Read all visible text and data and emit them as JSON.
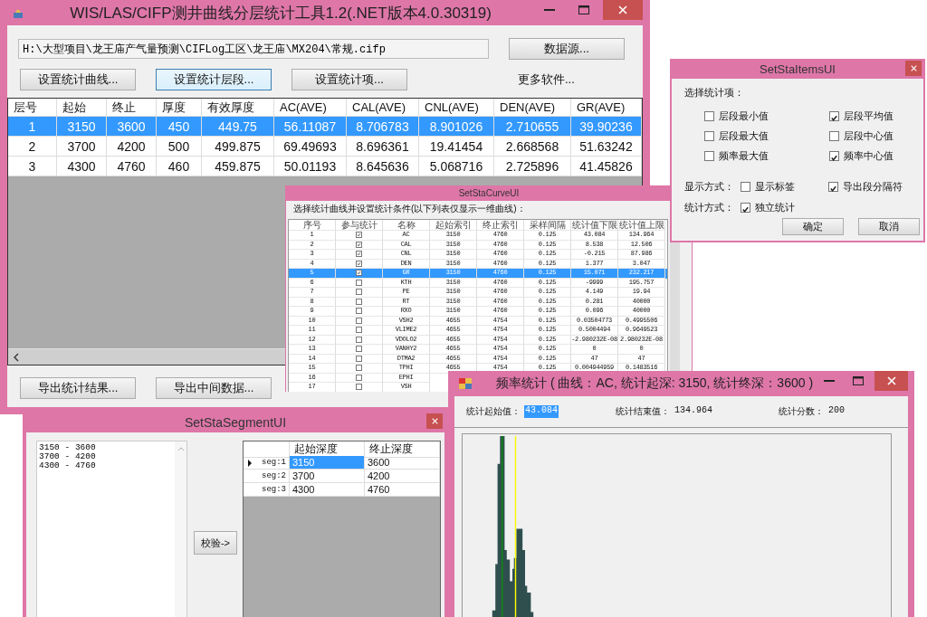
{
  "main_window": {
    "title": "WIS/LAS/CIFP测井曲线分层统计工具1.2(.NET版本4.0.30319)",
    "path_field": {
      "value": "H:\\大型项目\\龙王庙产气量预测\\CIFLog工区\\龙王庙\\MX204\\常规.cifp"
    },
    "data_source_button": "数据源...",
    "setting_buttons": [
      "设置统计曲线...",
      "设置统计层段...",
      "设置统计项..."
    ],
    "more_software": "更多软件...",
    "table": {
      "columns": [
        "层号",
        "起始",
        "终止",
        "厚度",
        "有效厚度",
        "AC(AVE)",
        "CAL(AVE)",
        "CNL(AVE)",
        "DEN(AVE)",
        "GR(AVE)"
      ],
      "rows": [
        {
          "selected": true,
          "cells": [
            "1",
            "3150",
            "3600",
            "450",
            "449.75",
            "56.11087",
            "8.706783",
            "8.901026",
            "2.710655",
            "39.90236"
          ]
        },
        {
          "selected": false,
          "cells": [
            "2",
            "3700",
            "4200",
            "500",
            "499.875",
            "69.49693",
            "8.696361",
            "19.41454",
            "2.668568",
            "51.63242"
          ]
        },
        {
          "selected": false,
          "cells": [
            "3",
            "4300",
            "4760",
            "460",
            "459.875",
            "50.01193",
            "8.645636",
            "5.068716",
            "2.725896",
            "41.45826"
          ]
        }
      ]
    },
    "export_buttons": [
      "导出统计结果...",
      "导出中间数据..."
    ]
  },
  "curve_window": {
    "title": "SetStaCurveUI",
    "instruction": "选择统计曲线并设置统计条件(以下列表仅显示一维曲线)：",
    "columns": [
      "序号",
      "参与统计",
      "名称",
      "起始索引",
      "终止索引",
      "采样间隔",
      "统计值下限",
      "统计值上限"
    ],
    "rows": [
      {
        "no": "1",
        "checked": true,
        "selected": false,
        "name": "AC",
        "start": "3150",
        "end": "4760",
        "step": "0.125",
        "lower": "43.084",
        "upper": "134.964"
      },
      {
        "no": "2",
        "checked": true,
        "selected": false,
        "name": "CAL",
        "start": "3150",
        "end": "4760",
        "step": "0.125",
        "lower": "8.538",
        "upper": "12.506"
      },
      {
        "no": "3",
        "checked": true,
        "selected": false,
        "name": "CNL",
        "start": "3150",
        "end": "4760",
        "step": "0.125",
        "lower": "-0.215",
        "upper": "87.986"
      },
      {
        "no": "4",
        "checked": true,
        "selected": false,
        "name": "DEN",
        "start": "3150",
        "end": "4760",
        "step": "0.125",
        "lower": "1.377",
        "upper": "3.047"
      },
      {
        "no": "5",
        "checked": true,
        "selected": true,
        "name": "GR",
        "start": "3150",
        "end": "4760",
        "step": "0.125",
        "lower": "15.071",
        "upper": "232.217"
      },
      {
        "no": "6",
        "checked": false,
        "selected": false,
        "name": "KTH",
        "start": "3150",
        "end": "4760",
        "step": "0.125",
        "lower": "-9999",
        "upper": "195.757"
      },
      {
        "no": "7",
        "checked": false,
        "selected": false,
        "name": "PE",
        "start": "3150",
        "end": "4760",
        "step": "0.125",
        "lower": "4.149",
        "upper": "19.94"
      },
      {
        "no": "8",
        "checked": false,
        "selected": false,
        "name": "RT",
        "start": "3150",
        "end": "4760",
        "step": "0.125",
        "lower": "0.281",
        "upper": "40000"
      },
      {
        "no": "9",
        "checked": false,
        "selected": false,
        "name": "RXO",
        "start": "3150",
        "end": "4760",
        "step": "0.125",
        "lower": "0.096",
        "upper": "40000"
      },
      {
        "no": "10",
        "checked": false,
        "selected": false,
        "name": "VSH2",
        "start": "4655",
        "end": "4754",
        "step": "0.125",
        "lower": "0.03504773",
        "upper": "0.4995506"
      },
      {
        "no": "11",
        "checked": false,
        "selected": false,
        "name": "VLIME2",
        "start": "4655",
        "end": "4754",
        "step": "0.125",
        "lower": "0.5004494",
        "upper": "0.9649523"
      },
      {
        "no": "12",
        "checked": false,
        "selected": false,
        "name": "VDOLO2",
        "start": "4655",
        "end": "4754",
        "step": "0.125",
        "lower": "-2.980232E-08",
        "upper": "2.980232E-08"
      },
      {
        "no": "13",
        "checked": false,
        "selected": false,
        "name": "VANHY2",
        "start": "4655",
        "end": "4754",
        "step": "0.125",
        "lower": "0",
        "upper": "0"
      },
      {
        "no": "14",
        "checked": false,
        "selected": false,
        "name": "DTMA2",
        "start": "4655",
        "end": "4754",
        "step": "0.125",
        "lower": "47",
        "upper": "47"
      },
      {
        "no": "15",
        "checked": false,
        "selected": false,
        "name": "TPHI",
        "start": "4655",
        "end": "4754",
        "step": "0.125",
        "lower": "0.004944959",
        "upper": "0.1483516"
      },
      {
        "no": "16",
        "checked": false,
        "selected": false,
        "name": "EPHI"
      },
      {
        "no": "17",
        "checked": false,
        "selected": false,
        "name": "VSH"
      }
    ]
  },
  "items_window": {
    "title": "SetStaItemsUI",
    "section_label": "选择统计项：",
    "items": [
      {
        "label": "层段最小值",
        "checked": false
      },
      {
        "label": "层段平均值",
        "checked": true
      },
      {
        "label": "层段最大值",
        "checked": false
      },
      {
        "label": "层段中心值",
        "checked": false
      },
      {
        "label": "频率最大值",
        "checked": false
      },
      {
        "label": "频率中心值",
        "checked": true
      }
    ],
    "display_label": "显示方式：",
    "display_options": [
      {
        "label": "显示标签",
        "checked": false
      },
      {
        "label": "导出段分隔符",
        "checked": true
      }
    ],
    "mode_label": "统计方式：",
    "mode_options": [
      {
        "label": "独立统计",
        "checked": true
      }
    ],
    "buttons": [
      "确定",
      "取消"
    ]
  },
  "segment_window": {
    "title": "SetStaSegmentUI",
    "text_lines": [
      "3150 - 3600",
      "3700 - 4200",
      "4300 - 4760"
    ],
    "verify_button": "校验->",
    "grid": {
      "columns": [
        "起始深度",
        "终止深度"
      ],
      "rows": [
        {
          "header": "seg:1",
          "current": true,
          "cells": [
            {
              "value": "3150",
              "selected": true
            },
            {
              "value": "3600",
              "selected": false
            }
          ]
        },
        {
          "header": "seg:2",
          "current": false,
          "cells": [
            {
              "value": "3700",
              "selected": false
            },
            {
              "value": "4200",
              "selected": false
            }
          ]
        },
        {
          "header": "seg:3",
          "current": false,
          "cells": [
            {
              "value": "4300",
              "selected": false
            },
            {
              "value": "4760",
              "selected": false
            }
          ]
        }
      ]
    }
  },
  "freq_window": {
    "title": "频率统计 (   曲线：AC,   统计起深: 3150,   统计终深：3600 )",
    "fields": [
      {
        "label": "统计起始值：",
        "value": "43.084",
        "selected": true
      },
      {
        "label": "统计结束值：",
        "value": "134.964",
        "selected": false
      },
      {
        "label": "统计分数：",
        "value": "200",
        "selected": false
      }
    ]
  }
}
